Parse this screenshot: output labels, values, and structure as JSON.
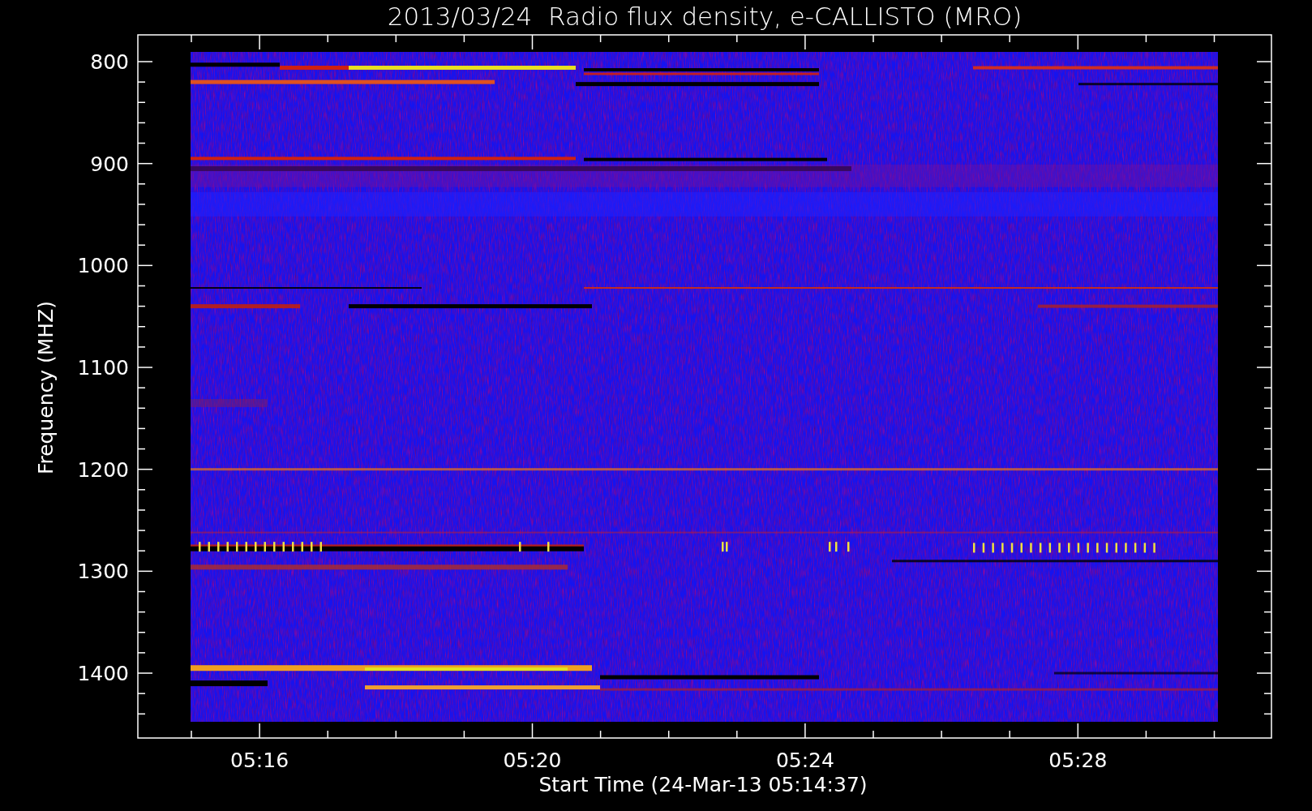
{
  "title": "2013/03/24  Radio flux density, e-CALLISTO (MRO)",
  "y_axis": {
    "label": "Frequency (MHZ)",
    "ticks": [
      "800",
      "900",
      "1000",
      "1100",
      "1200",
      "1300",
      "1400"
    ]
  },
  "x_axis": {
    "label": "Start Time (24-Mar-13 05:14:37)",
    "ticks": [
      "05:16",
      "05:20",
      "05:24",
      "05:28"
    ]
  }
}
